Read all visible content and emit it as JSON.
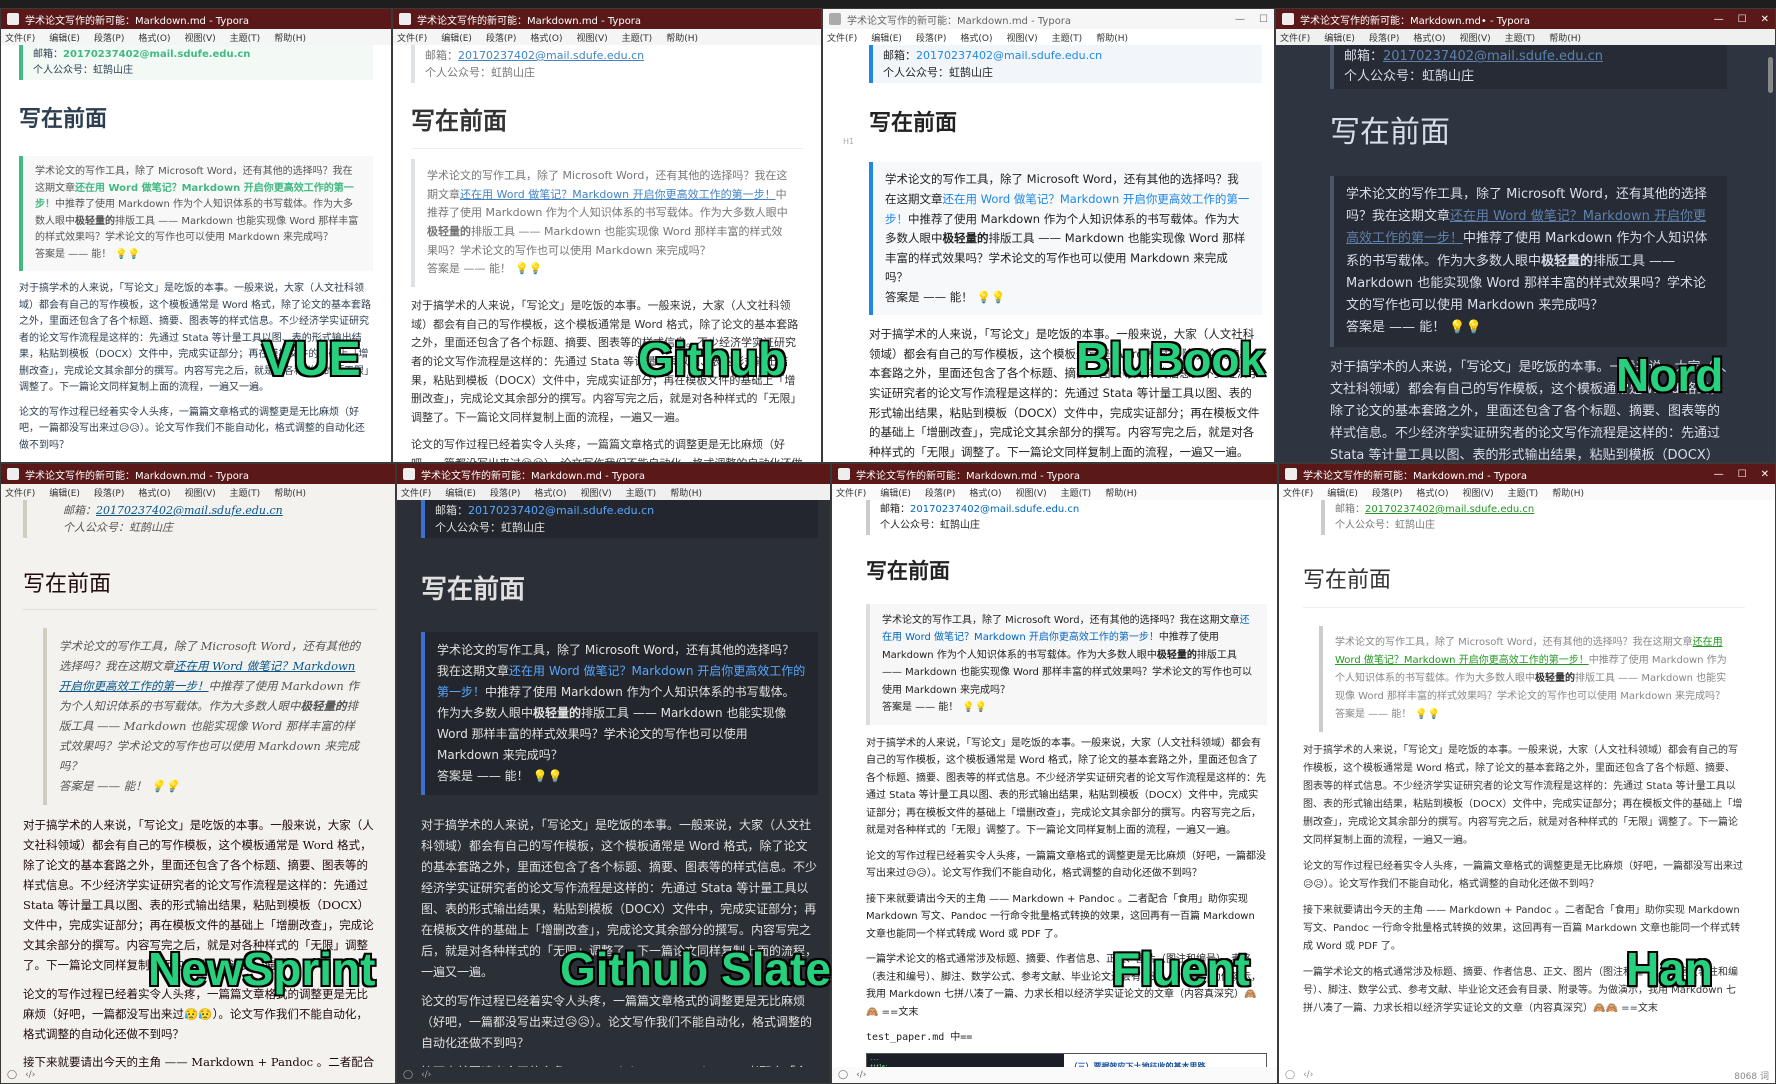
{
  "common": {
    "menu": [
      "文件(F)",
      "编辑(E)",
      "段落(P)",
      "格式(O)",
      "视图(V)",
      "主题(T)",
      "帮助(H)"
    ],
    "email_label": "邮箱：",
    "email": "20170237402@mail.sdufe.edu.cn",
    "wechat": "个人公众号：虹鹄山庄",
    "heading": "写在前面",
    "quote_pre": "学术论文的写作工具，除了 Microsoft Word，还有其他的选择吗？我在这期文章",
    "quote_link": "还在用 Word 做笔记？Markdown 开启你更高效工作的第一步！",
    "quote_mid": "中推荐了使用 Markdown 作为个人知识体系的书写载体。作为大多数人眼中",
    "quote_bold": "极轻量的",
    "quote_post": "排版工具 —— Markdown 也能实现像 Word 那样丰富的样式效果吗？学术论文的写作也可以使用 Markdown 来完成吗？",
    "quote_answer": "答案是 —— 能！",
    "bulbs": "💡💡",
    "p1": "对于搞学术的人来说，「写论文」是吃饭的本事。一般来说，大家（人文社科领域）都会有自己的写作模板，这个模板通常是 Word 格式，除了论文的基本套路之外，里面还包含了各个标题、摘要、图表等的样式信息。不少经济学实证研究者的论文写作流程是这样的：先通过 Stata 等计量工具以图、表的形式输出结果，粘贴到模板（DOCX）文件中，完成实证部分；再在模板文件的基础上「增删改查」，完成论文其余部分的撰写。内容写完之后，就是对各种样式的「无限」调整了。下一篇论文同样复制上面的流程，一遍又一遍。",
    "p2": "论文的写作过程已经着实令人头疼，一篇篇文章格式的调整更是无比麻烦（好吧，一篇都没写出来过😥😥）。论文写作我们不能自动化，格式调整的自动化还做不到吗？",
    "p3": "接下来就要请出今天的主角 —— Markdown + Pandoc 。二者配合「食用」助你实现 Markdown 写文、Pandoc 一行命令批量格式转换的效果，这回再有一百篇 Markdown 文章也能同一个样式转成 Word 或 PDF 了。",
    "p4": "一篇学术论文的格式通常涉及标题、摘要、作者信息、正文、图片（图注和编号）、表格（表注和编号）、脚注、数学公式、参考文献、毕业论文还会有目录、附录等。为做演示，我用 Markdown 七拼八凑了一篇、力求长相以经济学实证论文的文章（内容真深究）🙈🙈 ==文末",
    "test_file": "test_paper.md 中==",
    "thumb_heading": "（三）票据效应下土地征收的基本思路",
    "h1_marker": "H1",
    "word_count": "8068 词",
    "status_icons": "‹/›"
  },
  "windows": [
    {
      "id": "vue",
      "label": "VUE",
      "title": "学术论文写作的新可能：Markdown.md - Typora",
      "theme": "light"
    },
    {
      "id": "github",
      "label": "Github",
      "title": "学术论文写作的新可能：Markdown.md - Typora",
      "theme": "light"
    },
    {
      "id": "blubook",
      "label": "BluBook",
      "title": "学术论文写作的新可能：Markdown.md - Typora",
      "theme": "light"
    },
    {
      "id": "nord",
      "label": "Nord",
      "title": "学术论文写作的新可能：Markdown.md• - Typora",
      "theme": "dark"
    },
    {
      "id": "newsprint",
      "label": "NewSprint",
      "title": "学术论文写作的新可能：Markdown.md - Typora",
      "theme": "light"
    },
    {
      "id": "slate",
      "label": "Github Slate",
      "title": "学术论文写作的新可能：Markdown.md - Typora",
      "theme": "dark"
    },
    {
      "id": "fluent",
      "label": "Fluent",
      "title": "学术论文写作的新可能：Markdown.md - Typora",
      "theme": "light"
    },
    {
      "id": "han",
      "label": "Han",
      "title": "学术论文写作的新可能：Markdown.md - Typora",
      "theme": "light"
    }
  ],
  "window_controls": [
    "—",
    "☐",
    "✕"
  ],
  "colors": {
    "titlebar_dark": "#5a1818",
    "vue_accent": "#42b983",
    "github_link": "#4183c4",
    "blubook_accent": "#1e88e5",
    "nord_bg": "#2e3440",
    "nord_link": "#88c0d0",
    "slate_bg": "#2b2f36",
    "slate_link": "#58a6ff",
    "newsprint_bg": "#f3f2ee",
    "han_link": "#229922",
    "label_green": "#26d07c"
  }
}
